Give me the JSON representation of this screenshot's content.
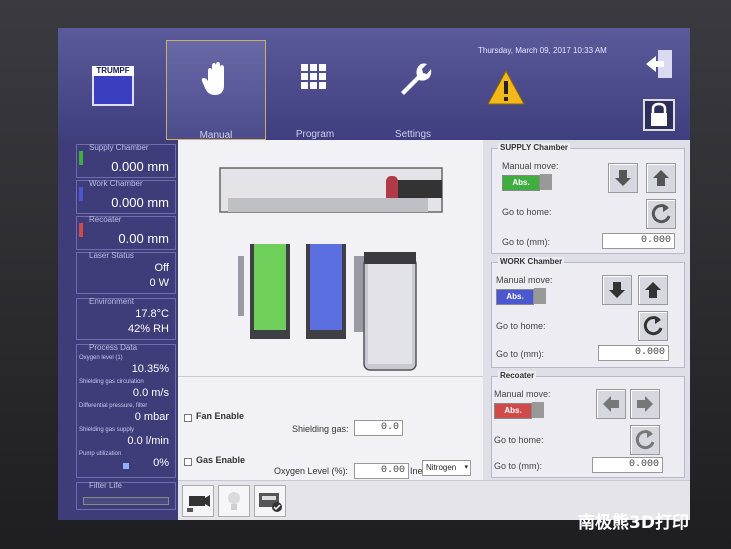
{
  "header": {
    "brand": "TRUMPF",
    "datetime": "Thursday, March 09, 2017 10:33 AM",
    "tabs": [
      {
        "label": "Manual",
        "icon": "hand-icon",
        "active": true
      },
      {
        "label": "Program",
        "icon": "grid-icon",
        "active": false
      },
      {
        "label": "Settings",
        "icon": "wrench-icon",
        "active": false
      }
    ],
    "warning_icon": "warning-icon",
    "exit_icon": "exit-icon",
    "lock_icon": "lock-icon"
  },
  "sidebar": {
    "supply": {
      "title": "Supply Chamber",
      "value": "0.000 mm",
      "color": "#3fae3f"
    },
    "work": {
      "title": "Work Chamber",
      "value": "0.000 mm",
      "color": "#4a57d0"
    },
    "recoater": {
      "title": "Recoater",
      "value": "0.00 mm",
      "color": "#d04a4a"
    },
    "laser": {
      "title": "Laser Status",
      "state": "Off",
      "power": "0 W"
    },
    "environment": {
      "title": "Environment",
      "temp": "17.8°C",
      "humidity": "42% RH"
    },
    "process": {
      "title": "Process Data",
      "items": [
        {
          "label": "Oxygen level (1)",
          "value": "10.35%"
        },
        {
          "label": "Shielding gas circulation",
          "value": "0.0 m/s"
        },
        {
          "label": "Differential pressure, filter",
          "value": "0 mbar"
        },
        {
          "label": "Shielding gas supply",
          "value": "0.0 l/min"
        },
        {
          "label": "Pump utilization",
          "value": "0%"
        }
      ]
    },
    "filter": {
      "title": "Filter Life"
    }
  },
  "panels": {
    "supply": {
      "title": "SUPPLY Chamber",
      "manual_move": "Manual move:",
      "abs_label": "Abs.",
      "abs_color": "#3fae3f",
      "go_home": "Go to home:",
      "go_to": "Go to (mm):",
      "go_to_value": "0.000"
    },
    "work": {
      "title": "WORK Chamber",
      "manual_move": "Manual move:",
      "abs_label": "Abs.",
      "abs_color": "#4a57d0",
      "go_home": "Go to home:",
      "go_to": "Go to (mm):",
      "go_to_value": "0.000"
    },
    "recoater": {
      "title": "Recoater",
      "manual_move": "Manual move:",
      "abs_label": "Abs.",
      "abs_color": "#d04a4a",
      "go_home": "Go to home:",
      "go_to": "Go to (mm):",
      "go_to_value": "0.000"
    }
  },
  "gas": {
    "fan_enable": "Fan Enable",
    "shielding_gas": "Shielding gas:",
    "shielding_value": "0.0",
    "gas_enable": "Gas Enable",
    "oxygen_level": "Oxygen Level (%):",
    "oxygen_value": "0.00",
    "inert_gas_type": "Inert Gas Type:",
    "inert_gas_selected": "Nitrogen"
  },
  "watermark": "南极熊3D打印"
}
